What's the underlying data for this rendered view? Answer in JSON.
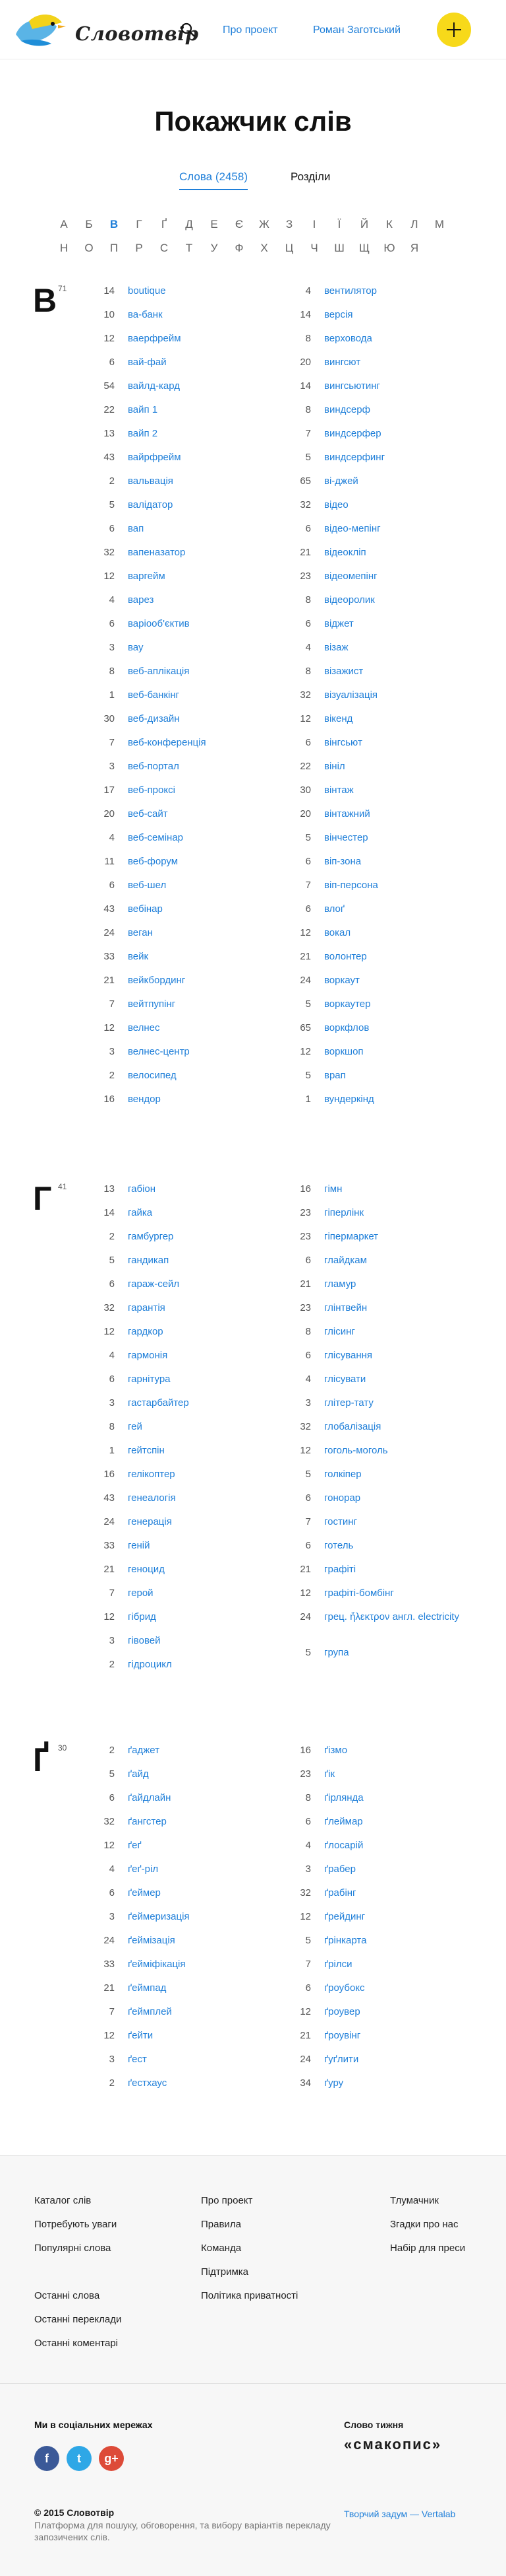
{
  "header": {
    "logo_text": "Словотвір",
    "nav": {
      "about": "Про проект",
      "author": "Роман Заготський"
    }
  },
  "main": {
    "title": "Покажчик слів",
    "tabs": {
      "words": "Слова (2458)",
      "sections": "Розділи"
    },
    "alphabet_row1": [
      "А",
      "Б",
      "В",
      "Г",
      "Ґ",
      "Д",
      "Е",
      "Є",
      "Ж",
      "З",
      "І",
      "Ї",
      "Й",
      "К",
      "Л",
      "М"
    ],
    "alphabet_row2": [
      "Н",
      "О",
      "П",
      "Р",
      "С",
      "Т",
      "У",
      "Ф",
      "Х",
      "Ц",
      "Ч",
      "Ш",
      "Щ",
      "Ю",
      "Я"
    ],
    "active_letter": "В"
  },
  "sections": [
    {
      "letter": "В",
      "count": "71",
      "left": [
        {
          "n": "14",
          "w": "boutique"
        },
        {
          "n": "10",
          "w": "ва-банк"
        },
        {
          "n": "12",
          "w": "ваерфрейм"
        },
        {
          "n": "6",
          "w": "вай-фай"
        },
        {
          "n": "54",
          "w": "вайлд-кард"
        },
        {
          "n": "22",
          "w": "вайп 1"
        },
        {
          "n": "13",
          "w": "вайп 2"
        },
        {
          "n": "43",
          "w": "вайрфрейм"
        },
        {
          "n": "2",
          "w": "вальвація"
        },
        {
          "n": "5",
          "w": "валідатор"
        },
        {
          "n": "6",
          "w": "вап"
        },
        {
          "n": "32",
          "w": "вапеназатор"
        },
        {
          "n": "12",
          "w": "варгейм"
        },
        {
          "n": "4",
          "w": "варез"
        },
        {
          "n": "6",
          "w": "варіооб'єктив"
        },
        {
          "n": "3",
          "w": "вау"
        },
        {
          "n": "8",
          "w": "веб-аплікація"
        },
        {
          "n": "1",
          "w": "веб-банкінг"
        },
        {
          "n": "30",
          "w": "веб-дизайн"
        },
        {
          "n": "7",
          "w": "веб-конференція"
        },
        {
          "n": "3",
          "w": "веб-портал"
        },
        {
          "n": "17",
          "w": "веб-проксі"
        },
        {
          "n": "20",
          "w": "веб-сайт"
        },
        {
          "n": "4",
          "w": "веб-семінар"
        },
        {
          "n": "11",
          "w": "веб-форум"
        },
        {
          "n": "6",
          "w": "веб-шел"
        },
        {
          "n": "43",
          "w": "вебінар"
        },
        {
          "n": "24",
          "w": "веган"
        },
        {
          "n": "33",
          "w": "вейк"
        },
        {
          "n": "21",
          "w": "вейкбординг"
        },
        {
          "n": "7",
          "w": "вейтпупінг"
        },
        {
          "n": "12",
          "w": "велнес"
        },
        {
          "n": "3",
          "w": "велнес-центр"
        },
        {
          "n": "2",
          "w": "велосипед"
        },
        {
          "n": "16",
          "w": "вендор"
        }
      ],
      "right": [
        {
          "n": "4",
          "w": "вентилятор"
        },
        {
          "n": "14",
          "w": "версія"
        },
        {
          "n": "8",
          "w": "верховода"
        },
        {
          "n": "20",
          "w": "вингсют"
        },
        {
          "n": "14",
          "w": "вингсьютинг"
        },
        {
          "n": "8",
          "w": "виндсерф"
        },
        {
          "n": "7",
          "w": "виндсерфер"
        },
        {
          "n": "5",
          "w": "виндсерфинг"
        },
        {
          "n": "65",
          "w": "ві-джей"
        },
        {
          "n": "32",
          "w": "відео"
        },
        {
          "n": "6",
          "w": "відео-мепінг"
        },
        {
          "n": "21",
          "w": "відеокліп"
        },
        {
          "n": "23",
          "w": "відеомепінг"
        },
        {
          "n": "8",
          "w": "відеоролик"
        },
        {
          "n": "6",
          "w": "віджет"
        },
        {
          "n": "4",
          "w": "візаж"
        },
        {
          "n": "8",
          "w": "візажист"
        },
        {
          "n": "32",
          "w": "візуалізація"
        },
        {
          "n": "12",
          "w": "вікенд"
        },
        {
          "n": "6",
          "w": "вінгсьют"
        },
        {
          "n": "22",
          "w": "вініл"
        },
        {
          "n": "30",
          "w": "вінтаж"
        },
        {
          "n": "20",
          "w": "вінтажний"
        },
        {
          "n": "5",
          "w": "вінчестер"
        },
        {
          "n": "6",
          "w": "віп-зона"
        },
        {
          "n": "7",
          "w": "віп-персона"
        },
        {
          "n": "6",
          "w": "влоґ"
        },
        {
          "n": "12",
          "w": "вокал"
        },
        {
          "n": "21",
          "w": "волонтер"
        },
        {
          "n": "24",
          "w": "воркаут"
        },
        {
          "n": "5",
          "w": "воркаутер"
        },
        {
          "n": "65",
          "w": "воркфлов"
        },
        {
          "n": "12",
          "w": "воркшоп"
        },
        {
          "n": "5",
          "w": "врап"
        },
        {
          "n": "1",
          "w": "вундеркінд"
        }
      ]
    },
    {
      "letter": "Г",
      "count": "41",
      "left": [
        {
          "n": "13",
          "w": "габіон"
        },
        {
          "n": "14",
          "w": "гайка"
        },
        {
          "n": "2",
          "w": "гамбургер"
        },
        {
          "n": "5",
          "w": "гандикап"
        },
        {
          "n": "6",
          "w": "гараж-сейл"
        },
        {
          "n": "32",
          "w": "гарантія"
        },
        {
          "n": "12",
          "w": "гардкор"
        },
        {
          "n": "4",
          "w": "гармонія"
        },
        {
          "n": "6",
          "w": "гарнітура"
        },
        {
          "n": "3",
          "w": "гастарбайтер"
        },
        {
          "n": "8",
          "w": "гей"
        },
        {
          "n": "1",
          "w": "гейтспін"
        },
        {
          "n": "16",
          "w": "гелікоптер"
        },
        {
          "n": "43",
          "w": "генеалогія"
        },
        {
          "n": "24",
          "w": "генерація"
        },
        {
          "n": "33",
          "w": "геній"
        },
        {
          "n": "21",
          "w": "геноцид"
        },
        {
          "n": "7",
          "w": "герой"
        },
        {
          "n": "12",
          "w": "гібрид"
        },
        {
          "n": "3",
          "w": "гівовей"
        },
        {
          "n": "2",
          "w": "гідроцикл"
        }
      ],
      "right": [
        {
          "n": "16",
          "w": "гімн"
        },
        {
          "n": "23",
          "w": "гіперлінк"
        },
        {
          "n": "23",
          "w": "гіпермаркет"
        },
        {
          "n": "6",
          "w": "глайдкам"
        },
        {
          "n": "21",
          "w": "гламур"
        },
        {
          "n": "23",
          "w": "глінтвейн"
        },
        {
          "n": "8",
          "w": "глісинг"
        },
        {
          "n": "6",
          "w": "глісування"
        },
        {
          "n": "4",
          "w": "глісувати"
        },
        {
          "n": "3",
          "w": "глітер-тату"
        },
        {
          "n": "32",
          "w": "глобалізація"
        },
        {
          "n": "12",
          "w": "гоголь-моголь"
        },
        {
          "n": "5",
          "w": "голкіпер"
        },
        {
          "n": "6",
          "w": "гонорар"
        },
        {
          "n": "7",
          "w": "гостинг"
        },
        {
          "n": "6",
          "w": "готель"
        },
        {
          "n": "21",
          "w": "графіті"
        },
        {
          "n": "12",
          "w": "графіті-бомбінг"
        },
        {
          "n": "24",
          "w": "грец. ἤλεκτρον англ. electricity"
        },
        {
          "n": "5",
          "w": "група"
        }
      ]
    },
    {
      "letter": "Ґ",
      "count": "30",
      "left": [
        {
          "n": "2",
          "w": "ґаджет"
        },
        {
          "n": "5",
          "w": "ґайд"
        },
        {
          "n": "6",
          "w": "ґайдлайн"
        },
        {
          "n": "32",
          "w": "ґангстер"
        },
        {
          "n": "12",
          "w": "ґеґ"
        },
        {
          "n": "4",
          "w": "ґеґ-ріл"
        },
        {
          "n": "6",
          "w": "ґеймер"
        },
        {
          "n": "3",
          "w": "ґеймеризація"
        },
        {
          "n": "24",
          "w": "ґеймізація"
        },
        {
          "n": "33",
          "w": "ґейміфікація"
        },
        {
          "n": "21",
          "w": "ґеймпад"
        },
        {
          "n": "7",
          "w": "ґеймплей"
        },
        {
          "n": "12",
          "w": "ґейти"
        },
        {
          "n": "3",
          "w": "ґест"
        },
        {
          "n": "2",
          "w": "ґестхаус"
        }
      ],
      "right": [
        {
          "n": "16",
          "w": "ґізмо"
        },
        {
          "n": "23",
          "w": "ґік"
        },
        {
          "n": "8",
          "w": "ґірлянда"
        },
        {
          "n": "6",
          "w": "ґлеймар"
        },
        {
          "n": "4",
          "w": "ґлосарій"
        },
        {
          "n": "3",
          "w": "ґрабер"
        },
        {
          "n": "32",
          "w": "ґрабінг"
        },
        {
          "n": "12",
          "w": "ґрейдинг"
        },
        {
          "n": "5",
          "w": "ґрінкарта"
        },
        {
          "n": "7",
          "w": "ґрілси"
        },
        {
          "n": "6",
          "w": "ґроубокс"
        },
        {
          "n": "12",
          "w": "ґроувер"
        },
        {
          "n": "21",
          "w": "ґроувінг"
        },
        {
          "n": "24",
          "w": "ґуґлити"
        },
        {
          "n": "34",
          "w": "ґуру"
        }
      ]
    }
  ],
  "footer": {
    "col1": [
      "Каталог слів",
      "Потребують уваги",
      "Популярні слова"
    ],
    "col1b": [
      "Останні слова",
      "Останні переклади",
      "Останні коментарі"
    ],
    "col2": [
      "Про проект",
      "Правила",
      "Команда",
      "Підтримка",
      "Політика приватності"
    ],
    "col3": [
      "Тлумачник",
      "Згадки про нас",
      "Набір для преси"
    ],
    "social_title": "Ми в соціальних мережах",
    "social": {
      "fb": "f",
      "tw": "t",
      "gp": "g+"
    },
    "smak_title": "Слово тижня",
    "smak_logo": "«смакопис»",
    "copyright": "© 2015 Словотвір",
    "description": "Платформа для пошуку, обговорення, та вибору варіантів перекладу запозичених слів.",
    "credit": "Творчий задум — Vertalab"
  }
}
